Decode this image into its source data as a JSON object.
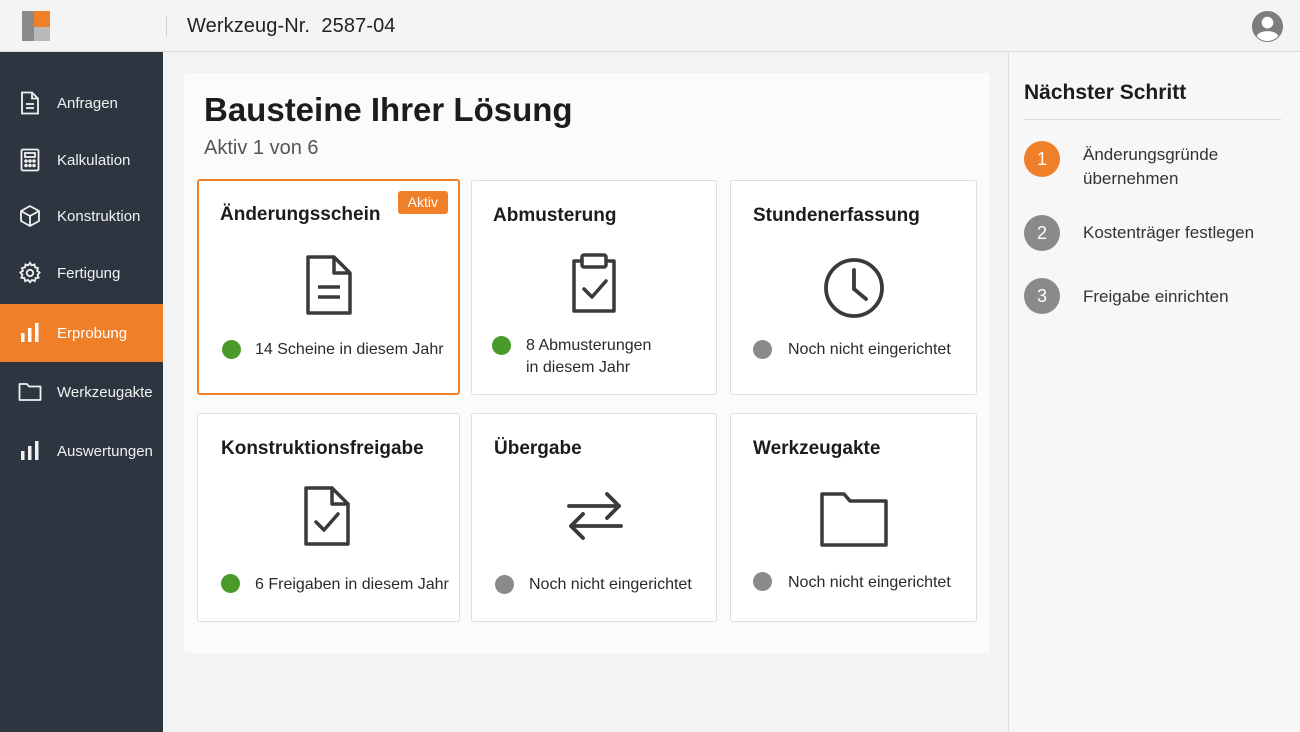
{
  "header": {
    "tool_label": "Werkzeug-Nr.",
    "tool_number": "2587-04"
  },
  "colors": {
    "accent": "#f07f2a",
    "sidebar_bg": "#2d3640",
    "status_green": "#4a9a2a",
    "status_grey": "#8a8a8a"
  },
  "sidebar": {
    "items": [
      {
        "label": "Anfragen",
        "icon": "document-icon"
      },
      {
        "label": "Kalkulation",
        "icon": "calculator-icon"
      },
      {
        "label": "Konstruktion",
        "icon": "cube-icon"
      },
      {
        "label": "Fertigung",
        "icon": "gear-icon"
      },
      {
        "label": "Erprobung",
        "icon": "bar-chart-icon",
        "active": true
      },
      {
        "label": "Werkzeugakte",
        "icon": "folder-icon"
      },
      {
        "label": "Auswertungen",
        "icon": "bar-chart-icon"
      }
    ]
  },
  "main": {
    "title": "Bausteine Ihrer Lösung",
    "subtitle": "Aktiv 1 von 6",
    "active_badge": "Aktiv",
    "cards": [
      {
        "title": "Änderungsschein",
        "icon": "document-icon",
        "status": "green",
        "line1": "14 Scheine in diesem Jahr",
        "line2": ""
      },
      {
        "title": "Abmusterung",
        "icon": "clipboard-check-icon",
        "status": "green",
        "line1": "8 Abmusterungen",
        "line2": "in diesem Jahr"
      },
      {
        "title": "Stundenerfassung",
        "icon": "clock-icon",
        "status": "grey",
        "line1": "Noch nicht eingerichtet",
        "line2": ""
      },
      {
        "title": "Konstruktionsfreigabe",
        "icon": "document-check-icon",
        "status": "green",
        "line1": "6 Freigaben in diesem Jahr",
        "line2": ""
      },
      {
        "title": "Übergabe",
        "icon": "transfer-arrows-icon",
        "status": "grey",
        "line1": "Noch nicht eingerichtet",
        "line2": ""
      },
      {
        "title": "Werkzeugakte",
        "icon": "folder-icon",
        "status": "grey",
        "line1": "Noch nicht eingerichtet",
        "line2": ""
      }
    ]
  },
  "next_steps": {
    "title": "Nächster Schritt",
    "steps": [
      {
        "number": "1",
        "line1": "Änderungsgründe",
        "line2": "übernehmen",
        "state": "current"
      },
      {
        "number": "2",
        "line1": "Kostenträger festlegen",
        "line2": "",
        "state": "pending"
      },
      {
        "number": "3",
        "line1": "Freigabe einrichten",
        "line2": "",
        "state": "pending"
      }
    ]
  }
}
